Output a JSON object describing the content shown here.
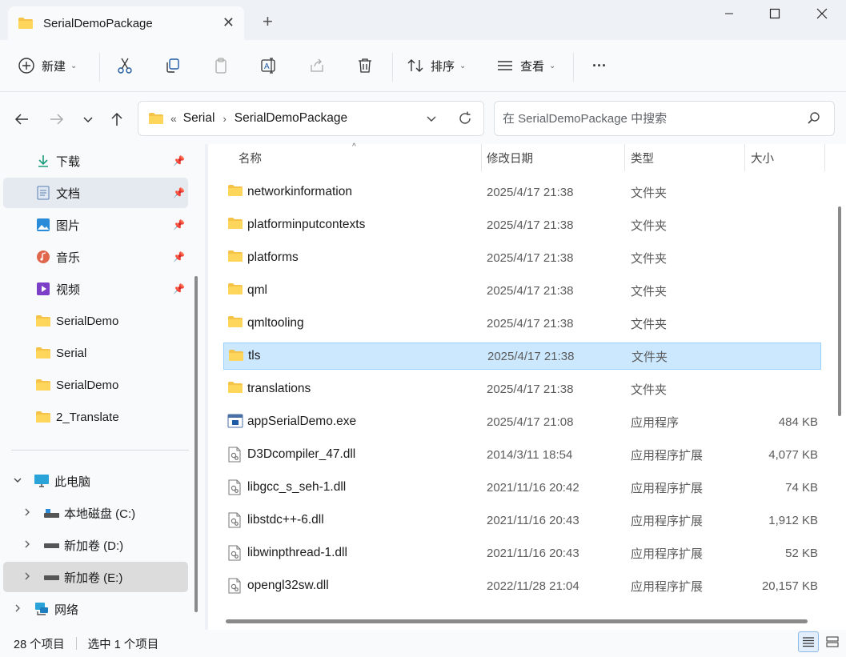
{
  "window": {
    "tab_title": "SerialDemoPackage",
    "tab_close": "✕",
    "new_tab": "+"
  },
  "toolbar": {
    "new_label": "新建",
    "sort_label": "排序",
    "view_label": "查看",
    "more": "···"
  },
  "address": {
    "overflow": "«",
    "crumbs": [
      "Serial",
      "SerialDemoPackage"
    ],
    "separator": "›"
  },
  "search": {
    "placeholder": "在 SerialDemoPackage 中搜索"
  },
  "sidebar": {
    "quick_access": [
      {
        "label": "下载",
        "icon": "download-icon",
        "pinned": true
      },
      {
        "label": "文档",
        "icon": "document-icon",
        "pinned": true
      },
      {
        "label": "图片",
        "icon": "pictures-icon",
        "pinned": true
      },
      {
        "label": "音乐",
        "icon": "music-icon",
        "pinned": true
      },
      {
        "label": "视频",
        "icon": "video-icon",
        "pinned": true
      },
      {
        "label": "SerialDemo",
        "icon": "folder-icon",
        "pinned": false
      },
      {
        "label": "Serial",
        "icon": "folder-icon",
        "pinned": false
      },
      {
        "label": "SerialDemo",
        "icon": "folder-icon",
        "pinned": false
      },
      {
        "label": "2_Translate",
        "icon": "folder-icon",
        "pinned": false
      }
    ],
    "this_pc": "此电脑",
    "drives": [
      {
        "label": "本地磁盘 (C:)"
      },
      {
        "label": "新加卷 (D:)"
      },
      {
        "label": "新加卷 (E:)"
      }
    ],
    "network": "网络"
  },
  "columns": {
    "name": "名称",
    "date": "修改日期",
    "type": "类型",
    "size": "大小"
  },
  "files": [
    {
      "name": "networkinformation",
      "date": "2025/4/17 21:38",
      "type": "文件夹",
      "size": "",
      "kind": "folder"
    },
    {
      "name": "platforminputcontexts",
      "date": "2025/4/17 21:38",
      "type": "文件夹",
      "size": "",
      "kind": "folder"
    },
    {
      "name": "platforms",
      "date": "2025/4/17 21:38",
      "type": "文件夹",
      "size": "",
      "kind": "folder"
    },
    {
      "name": "qml",
      "date": "2025/4/17 21:38",
      "type": "文件夹",
      "size": "",
      "kind": "folder"
    },
    {
      "name": "qmltooling",
      "date": "2025/4/17 21:38",
      "type": "文件夹",
      "size": "",
      "kind": "folder"
    },
    {
      "name": "tls",
      "date": "2025/4/17 21:38",
      "type": "文件夹",
      "size": "",
      "kind": "folder"
    },
    {
      "name": "translations",
      "date": "2025/4/17 21:38",
      "type": "文件夹",
      "size": "",
      "kind": "folder"
    },
    {
      "name": "appSerialDemo.exe",
      "date": "2025/4/17 21:08",
      "type": "应用程序",
      "size": "484 KB",
      "kind": "exe"
    },
    {
      "name": "D3Dcompiler_47.dll",
      "date": "2014/3/11 18:54",
      "type": "应用程序扩展",
      "size": "4,077 KB",
      "kind": "dll"
    },
    {
      "name": "libgcc_s_seh-1.dll",
      "date": "2021/11/16 20:42",
      "type": "应用程序扩展",
      "size": "74 KB",
      "kind": "dll"
    },
    {
      "name": "libstdc++-6.dll",
      "date": "2021/11/16 20:43",
      "type": "应用程序扩展",
      "size": "1,912 KB",
      "kind": "dll"
    },
    {
      "name": "libwinpthread-1.dll",
      "date": "2021/11/16 20:43",
      "type": "应用程序扩展",
      "size": "52 KB",
      "kind": "dll"
    },
    {
      "name": "opengl32sw.dll",
      "date": "2022/11/28 21:04",
      "type": "应用程序扩展",
      "size": "20,157 KB",
      "kind": "dll"
    }
  ],
  "status": {
    "count": "28 个项目",
    "selected": "选中 1 个项目"
  },
  "colors": {
    "accent": "#0067c0",
    "folder": "#f5c348",
    "selection": "#cce8ff"
  }
}
